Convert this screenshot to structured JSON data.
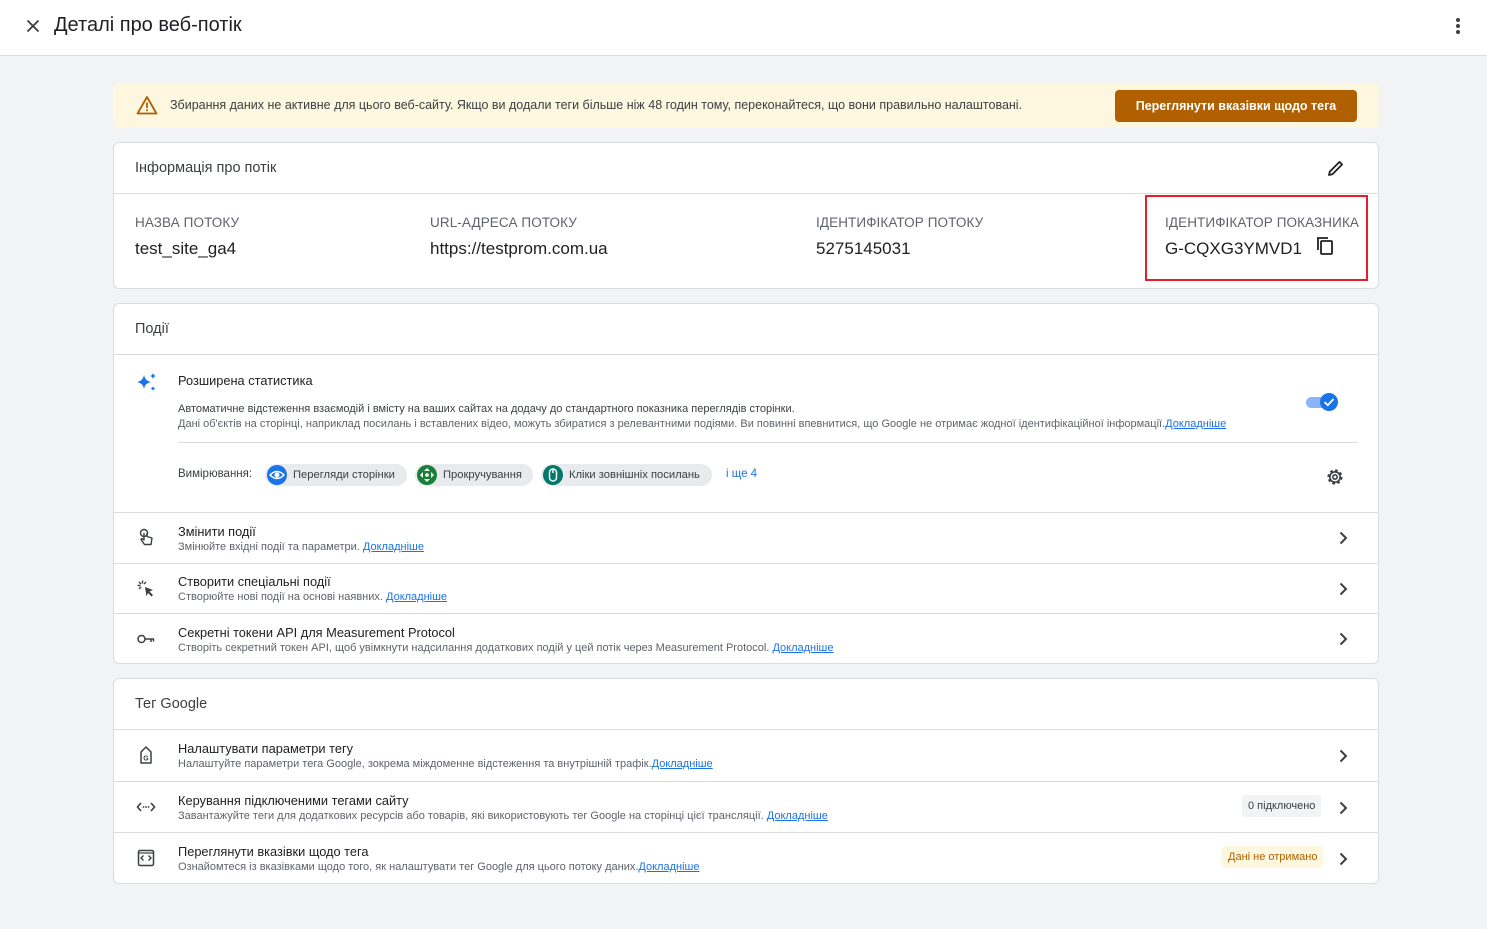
{
  "header": {
    "title": "Деталі про веб-потік"
  },
  "banner": {
    "message": "Збирання даних не активне для цього веб-сайту. Якщо ви додали теги більше ніж 48 годин тому, переконайтеся, що вони правильно налаштовані.",
    "button_label": "Переглянути вказівки щодо тега"
  },
  "stream_info": {
    "heading": "Інформація про потік",
    "fields": [
      {
        "label": "НАЗВА ПОТОКУ",
        "value": "test_site_ga4"
      },
      {
        "label": "URL-АДРЕСА ПОТОКУ",
        "value": "https://testprom.com.ua"
      },
      {
        "label": "ІДЕНТИФІКАТОР ПОТОКУ",
        "value": "5275145031"
      },
      {
        "label": "ІДЕНТИФІКАТОР ПОКАЗНИКА",
        "value": "G-CQXG3YMVD1"
      }
    ]
  },
  "events": {
    "heading": "Події",
    "enhanced": {
      "title": "Розширена статистика",
      "desc_line1": "Автоматичне відстеження взаємодій і вмісту на ваших сайтах на додачу до стандартного показника переглядів сторінки.",
      "desc_line2": "Дані об'єктів на сторінці, наприклад посилань і вставлених відео, можуть збиратися з релевантними подіями. Ви повинні впевнитися, що Google не отримає жодної ідентифікаційної інформації.",
      "learn_more": "Докладніше",
      "toggle_on": true,
      "measuring_label": "Вимірювання:",
      "chips": [
        "Перегляди сторінки",
        "Прокручування",
        "Кліки зовнішніх посилань"
      ],
      "more_label": "і ще 4"
    },
    "rows": [
      {
        "title": "Змінити події",
        "desc": "Змінюйте вхідні події та параметри. ",
        "link": "Докладніше"
      },
      {
        "title": "Створити спеціальні події",
        "desc": "Створюйте нові події на основі наявних. ",
        "link": "Докладніше"
      },
      {
        "title": "Секретні токени API для Measurement Protocol",
        "desc": "Створіть секретний токен API, щоб увімкнути надсилання додаткових подій у цей потік через Measurement Protocol. ",
        "link": "Докладніше"
      }
    ]
  },
  "google_tag": {
    "heading": "Тег Google",
    "rows": [
      {
        "title": "Налаштувати параметри тегу",
        "desc": "Налаштуйте параметри тега Google, зокрема міждоменне відстеження та внутрішній трафік.",
        "link": "Докладніше",
        "badge": ""
      },
      {
        "title": "Керування підключеними тегами сайту",
        "desc": "Завантажуйте теги для додаткових ресурсів або товарів, які використовують тег Google на сторінці цієї трансляції. ",
        "link": "Докладніше",
        "badge": "0 підключено"
      },
      {
        "title": "Переглянути вказівки щодо тега",
        "desc": "Ознайомтеся із вказівками щодо того, як налаштувати тег Google для цього потоку даних.",
        "link": "Докладніше",
        "badge": "Дані не отримано"
      }
    ]
  },
  "colors": {
    "accent": "#1a73e8",
    "warning_button": "#b06000",
    "banner_bg": "#fef7e0",
    "highlight_box": "#e61e2b"
  }
}
